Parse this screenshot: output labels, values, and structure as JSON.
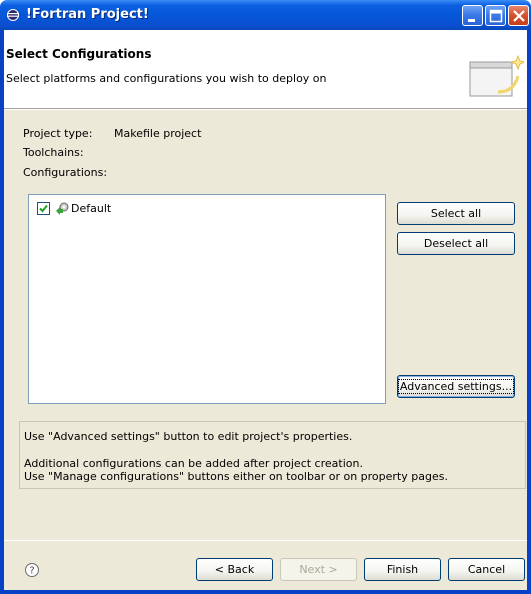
{
  "window": {
    "title": "!Fortran Project!",
    "icons": {
      "app": "eclipse-icon",
      "minimize": "minimize-icon",
      "maximize": "maximize-icon",
      "close": "close-icon"
    }
  },
  "header": {
    "title": "Select Configurations",
    "description": "Select platforms and configurations you wish to deploy on",
    "graphic": "wizard-banner-icon"
  },
  "project_info": {
    "project_type_label": "Project type:",
    "project_type_value": "Makefile project",
    "toolchains_label": "Toolchains:",
    "configurations_label": "Configurations:"
  },
  "configurations": [
    {
      "label": "Default",
      "checked": true,
      "icon": "configuration-icon"
    }
  ],
  "side_buttons": {
    "select_all": "Select all",
    "deselect_all": "Deselect all",
    "advanced_settings": "Advanced settings..."
  },
  "info": {
    "line1": "Use \"Advanced settings\" button to edit project's properties.",
    "line2": "Additional configurations can be added after project creation.",
    "line3": "Use \"Manage configurations\" buttons either on toolbar or on property pages."
  },
  "footer": {
    "help_icon": "help-icon",
    "back": "< Back",
    "next": "Next >",
    "finish": "Finish",
    "cancel": "Cancel"
  },
  "colors": {
    "titlebar": "#0557d8",
    "dialog_bg": "#ece9d8",
    "button_border": "#003c74"
  }
}
